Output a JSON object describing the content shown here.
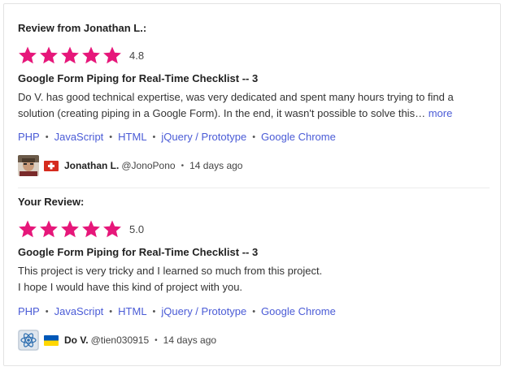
{
  "reviews": [
    {
      "heading": "Review from Jonathan L.:",
      "rating": "4.8",
      "stars": 5,
      "project_title": "Google Form Piping for Real-Time Checklist -- 3",
      "body_lines": [
        "Do V. has good technical expertise, was very dedicated and spent many hours trying to find a",
        "solution (creating piping in a Google Form). In the end, it wasn't possible to solve this…"
      ],
      "more_label": "more",
      "tags": [
        "PHP",
        "JavaScript",
        "HTML",
        "jQuery / Prototype",
        "Google Chrome"
      ],
      "user": {
        "name": "Jonathan L.",
        "handle": "@JonoPono",
        "time": "14 days ago",
        "flag": "switzerland-flag-icon"
      }
    },
    {
      "heading": "Your Review:",
      "rating": "5.0",
      "stars": 5,
      "project_title": "Google Form Piping for Real-Time Checklist -- 3",
      "body_lines": [
        "This project is very tricky and I learned so much from this project.",
        "I hope I would have this kind of project with you."
      ],
      "tags": [
        "PHP",
        "JavaScript",
        "HTML",
        "jQuery / Prototype",
        "Google Chrome"
      ],
      "user": {
        "name": "Do V.",
        "handle": "@tien030915",
        "time": "14 days ago",
        "flag": "ukraine-flag-icon"
      }
    }
  ],
  "colors": {
    "star": "#e6177a",
    "link": "#4a5bd6"
  }
}
